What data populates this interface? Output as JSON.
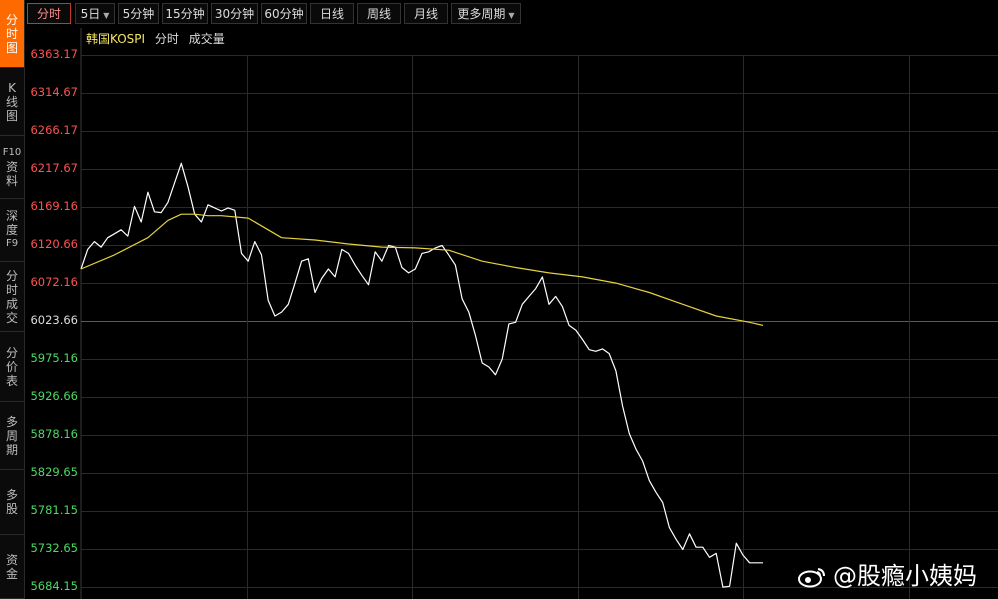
{
  "sidebar": {
    "tabs": [
      {
        "lines": [
          "分",
          "时",
          "图"
        ],
        "active": true
      },
      {
        "lines": [
          "K",
          "线",
          "图"
        ],
        "active": false
      },
      {
        "lines": [
          "F10",
          "资",
          "料"
        ],
        "active": false
      },
      {
        "lines": [
          "深",
          "度",
          "F9"
        ],
        "active": false
      },
      {
        "lines": [
          "分",
          "时",
          "成",
          "交"
        ],
        "active": false
      },
      {
        "lines": [
          "分",
          "价",
          "表"
        ],
        "active": false
      },
      {
        "lines": [
          "多",
          "周",
          "期"
        ],
        "active": false
      },
      {
        "lines": [
          "多",
          "股"
        ],
        "active": false
      },
      {
        "lines": [
          "资",
          "金"
        ],
        "active": false
      }
    ]
  },
  "toolbar": {
    "buttons": [
      {
        "label": "分时",
        "active": true,
        "dropdown": false
      },
      {
        "label": "5日",
        "active": false,
        "dropdown": true
      },
      {
        "label": "5分钟",
        "active": false,
        "dropdown": false
      },
      {
        "label": "15分钟",
        "active": false,
        "dropdown": false
      },
      {
        "label": "30分钟",
        "active": false,
        "dropdown": false
      },
      {
        "label": "60分钟",
        "active": false,
        "dropdown": false
      },
      {
        "label": "日线",
        "active": false,
        "dropdown": false
      },
      {
        "label": "周线",
        "active": false,
        "dropdown": false
      },
      {
        "label": "月线",
        "active": false,
        "dropdown": false
      },
      {
        "label": "更多周期",
        "active": false,
        "dropdown": true
      }
    ]
  },
  "legend": {
    "index_name": "韩国KOSPI",
    "items": [
      "分时",
      "成交量"
    ]
  },
  "colors": {
    "up": "#ff5252",
    "down": "#4cd964",
    "price_line": "#ffffff",
    "avg_line": "#e6d23c",
    "grid": "#2a2a2a",
    "active_tab": "#ff6a00"
  },
  "chart_data": {
    "type": "line",
    "title": "",
    "y_ticks": [
      "6363.17",
      "6314.67",
      "6266.17",
      "6217.67",
      "6169.16",
      "6120.66",
      "6072.16",
      "6023.66",
      "5975.16",
      "5926.66",
      "5878.16",
      "5829.65",
      "5781.15",
      "5732.65",
      "5684.15"
    ],
    "y_tick_class": [
      "up",
      "up",
      "up",
      "up",
      "up",
      "up",
      "up",
      "mid",
      "down",
      "down",
      "down",
      "down",
      "down",
      "down",
      "down"
    ],
    "prev_close": 6023.66,
    "ylim": [
      5684.15,
      6363.17
    ],
    "sessions": 5,
    "x_index_max": 100,
    "series": [
      {
        "x": [
          0,
          1,
          2,
          3,
          4,
          5,
          6,
          7,
          8,
          9,
          10,
          11,
          12,
          13,
          14,
          15,
          16,
          17,
          18,
          19,
          20,
          21,
          22,
          23,
          24,
          25,
          26,
          27,
          28,
          29,
          30,
          31,
          32,
          33,
          34,
          35,
          36,
          37,
          38,
          39,
          40,
          41,
          42,
          43,
          44,
          45,
          46,
          47,
          48,
          49,
          50,
          51,
          52,
          53,
          54,
          55,
          56,
          57,
          58,
          59,
          60,
          61,
          62,
          63,
          64,
          65,
          66,
          67,
          68,
          69,
          70,
          71,
          72,
          73,
          74,
          75,
          76,
          77,
          78,
          79,
          80,
          81,
          82,
          83,
          84,
          85,
          86,
          87,
          88,
          89,
          90,
          91,
          92,
          93,
          94,
          95,
          96,
          97,
          98,
          99,
          100,
          101,
          102
        ],
        "values": [
          6090,
          6115,
          6125,
          6118,
          6130,
          6135,
          6140,
          6132,
          6170,
          6150,
          6188,
          6163,
          6162,
          6175,
          6200,
          6225,
          6195,
          6160,
          6150,
          6172,
          6168,
          6164,
          6168,
          6165,
          6110,
          6100,
          6125,
          6108,
          6050,
          6030,
          6035,
          6045,
          6072,
          6100,
          6103,
          6060,
          6078,
          6090,
          6080,
          6115,
          6110,
          6095,
          6082,
          6070,
          6112,
          6100,
          6120,
          6118,
          6092,
          6085,
          6090,
          6110,
          6112,
          6117,
          6120,
          6108,
          6095,
          6052,
          6035,
          6005,
          5970,
          5965,
          5955,
          5975,
          6020,
          6022,
          6045,
          6055,
          6065,
          6080,
          6045,
          6055,
          6042,
          6018,
          6012,
          6000,
          5987,
          5985,
          5988,
          5982,
          5960,
          5915,
          5880,
          5860,
          5845,
          5820,
          5805,
          5792,
          5760,
          5745,
          5732,
          5752,
          5735,
          5735,
          5722,
          5727,
          5684,
          5685,
          5740,
          5725,
          5715,
          5715,
          5715
        ],
        "name": ""
      },
      {
        "x": [
          0,
          5,
          10,
          13,
          15,
          17,
          19,
          21,
          25,
          30,
          35,
          40,
          45,
          50,
          55,
          60,
          65,
          70,
          75,
          80,
          85,
          90,
          95,
          100,
          102
        ],
        "values": [
          6090,
          6108,
          6130,
          6152,
          6160,
          6160,
          6158,
          6158,
          6155,
          6130,
          6127,
          6122,
          6118,
          6117,
          6114,
          6100,
          6092,
          6085,
          6080,
          6072,
          6060,
          6045,
          6030,
          6022,
          6018
        ],
        "name": ""
      }
    ]
  },
  "watermark": {
    "text": "@股瘾小姨妈",
    "icon": "weibo-icon"
  }
}
